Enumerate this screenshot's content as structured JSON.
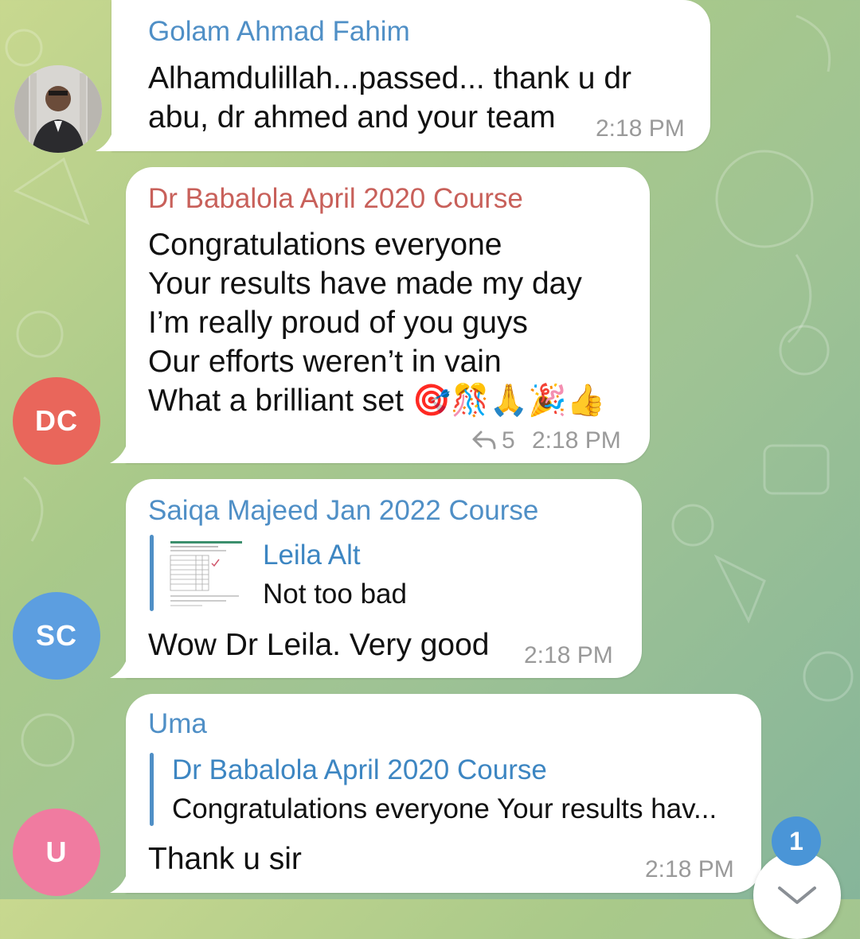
{
  "colors": {
    "accent_blue": "#4a95d7",
    "sender_blue": "#4f8fc6",
    "sender_red": "#c8605a",
    "avatar_dc": "#e9665b",
    "avatar_sc": "#5c9ee0",
    "avatar_u": "#f07ba0"
  },
  "messages": [
    {
      "sender": "Golam Ahmad Fahim",
      "text": "Alhamdulillah...passed... thank u dr\nabu, dr ahmed and your team",
      "time": "2:18 PM"
    },
    {
      "avatar_initials": "DC",
      "sender": "Dr Babalola April 2020 Course",
      "text": "Congratulations everyone\nYour results have made my day\nI’m really proud of you guys\nOur efforts weren’t in vain\nWhat a brilliant set 🎯🎊🙏🎉👍",
      "forwards": "5",
      "time": "2:18 PM"
    },
    {
      "avatar_initials": "SC",
      "sender": "Saiqa Majeed Jan 2022 Course",
      "reply_title": "Leila Alt",
      "reply_text": "Not too bad",
      "text": "Wow Dr Leila. Very good",
      "time": "2:18 PM"
    },
    {
      "avatar_initials": "U",
      "sender": "Uma",
      "reply_title": "Dr Babalola April 2020 Course",
      "reply_text": "Congratulations everyone  Your results hav...",
      "text": "Thank u sir",
      "time": "2:18 PM"
    }
  ],
  "unread_badge": "1",
  "icons": [
    "reply-arrow-icon",
    "chevron-down-icon",
    "spreadsheet-thumbnail"
  ]
}
